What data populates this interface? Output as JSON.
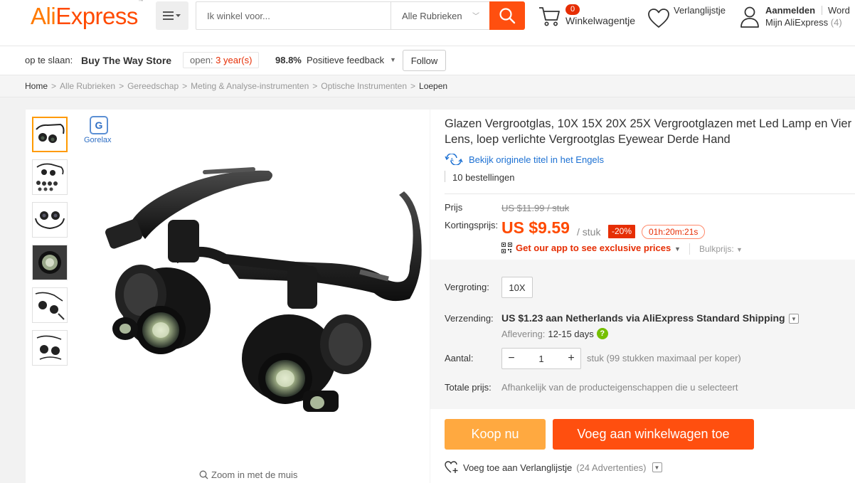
{
  "header": {
    "logo_main": "AliExpress",
    "logo_tm": "™",
    "search_placeholder": "Ik winkel voor...",
    "search_category": "Alle Rubrieken",
    "cart_count": "0",
    "cart_label": "Winkelwagentje",
    "wishlist_label": "Verlanglijstje",
    "signin_label": "Aanmelden",
    "join_label": "Word",
    "myali_label": "Mijn AliExpress",
    "myali_count": "(4)",
    "brand_colors": {
      "orange": "#ff7a00",
      "red_orange": "#ff4a00",
      "search_button": "#ff4f0f"
    }
  },
  "store": {
    "prefix": "op te slaan:",
    "name": "Buy The Way Store",
    "open_label": "open:",
    "open_years": "3 year(s)",
    "feedback_pct": "98.8%",
    "feedback_label": "Positieve feedback",
    "follow_label": "Follow"
  },
  "breadcrumb": [
    "Home",
    "Alle Rubrieken",
    "Gereedschap",
    "Meting & Analyse-instrumenten",
    "Optische Instrumenten",
    "Loepen"
  ],
  "gallery": {
    "brand_name": "Gorelax",
    "brand_letter": "G",
    "thumb_count": 6,
    "zoom_hint": "Zoom in met de muis"
  },
  "product": {
    "title": "Glazen Vergrootglas, 10X 15X 20X 25X Vergrootglazen met Led Lamp en Vier Lens, loep verlichte Vergrootglas Eyewear Derde Hand",
    "translate_link": "Bekijk originele titel in het Engels",
    "orders": "10 bestellingen",
    "price_label": "Prijs",
    "price_original": "US $11.99 / stuk",
    "discount_price_label": "Kortingsprijs:",
    "price_current": "US $9.59",
    "price_unit": "/ stuk",
    "discount_badge": "-20%",
    "countdown": "01h:20m:21s",
    "app_link": "Get our app to see exclusive prices",
    "bulk_label": "Bulkprijs:",
    "variant_label": "Vergroting:",
    "variant_value": "10X",
    "shipping_label": "Verzending:",
    "shipping_text": "US $1.23 aan Netherlands via AliExpress Standard Shipping",
    "delivery_label": "Aflevering:",
    "delivery_value": "12-15 days",
    "qty_label": "Aantal:",
    "qty_value": "1",
    "qty_note": "stuk (99 stukken maximaal per koper)",
    "total_label": "Totale prijs:",
    "total_value": "Afhankelijk van de producteigenschappen die u selecteert",
    "buy_now": "Koop nu",
    "add_to_cart": "Voeg aan winkelwagen toe",
    "wishlist_add": "Voeg toe aan Verlanglijstje",
    "wishlist_count": "(24 Advertenties)"
  }
}
